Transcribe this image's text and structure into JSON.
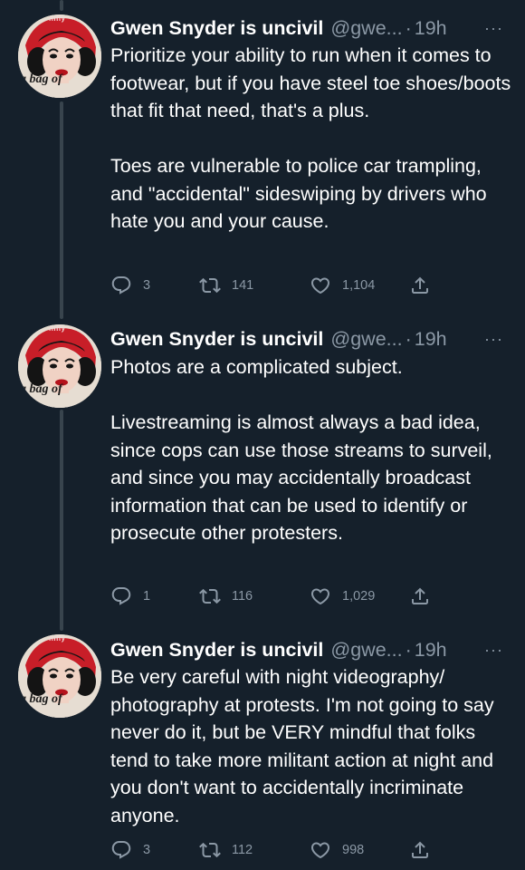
{
  "tweets": [
    {
      "author": {
        "name": "Gwen Snyder is uncivil",
        "handle": "@gwe...",
        "avatar_caption": "a bag of",
        "avatar_top_word": "nilly"
      },
      "time": "19h",
      "separator": "·",
      "more_label": "···",
      "paragraphs": [
        "Prioritize your ability to run when it comes to footwear, but if you have steel toe shoes/boots that fit that need, that's a plus.",
        "Toes are vulnerable to police car trampling, and \"accidental\" sideswiping by drivers who hate you and your cause."
      ],
      "stats": {
        "replies": "3",
        "retweets": "141",
        "likes": "1,104"
      }
    },
    {
      "author": {
        "name": "Gwen Snyder is uncivil",
        "handle": "@gwe...",
        "avatar_caption": "a bag of",
        "avatar_top_word": "nilly"
      },
      "time": "19h",
      "separator": "·",
      "more_label": "···",
      "paragraphs": [
        "Photos are a complicated subject.",
        "Livestreaming is almost always a bad idea, since cops can use those streams to surveil, and since you may accidentally broadcast information that can be used to identify or prosecute other protesters."
      ],
      "stats": {
        "replies": "1",
        "retweets": "116",
        "likes": "1,029"
      }
    },
    {
      "author": {
        "name": "Gwen Snyder is uncivil",
        "handle": "@gwe...",
        "avatar_caption": "a bag of",
        "avatar_top_word": "nilly"
      },
      "time": "19h",
      "separator": "·",
      "more_label": "···",
      "paragraphs": [
        "Be very careful with night videography/ photography at protests. I'm not going to say never do it, but be VERY mindful that folks tend to take more militant action at night and you don't want to accidentally incriminate anyone."
      ],
      "stats": {
        "replies": "3",
        "retweets": "112",
        "likes": "998"
      }
    }
  ],
  "icons": {
    "reply": "reply-icon",
    "retweet": "retweet-icon",
    "like": "heart-icon",
    "share": "share-icon"
  },
  "colors": {
    "background": "#15202b",
    "text_primary": "#ffffff",
    "text_secondary": "#8b98a5",
    "thread_line": "#38444d"
  }
}
